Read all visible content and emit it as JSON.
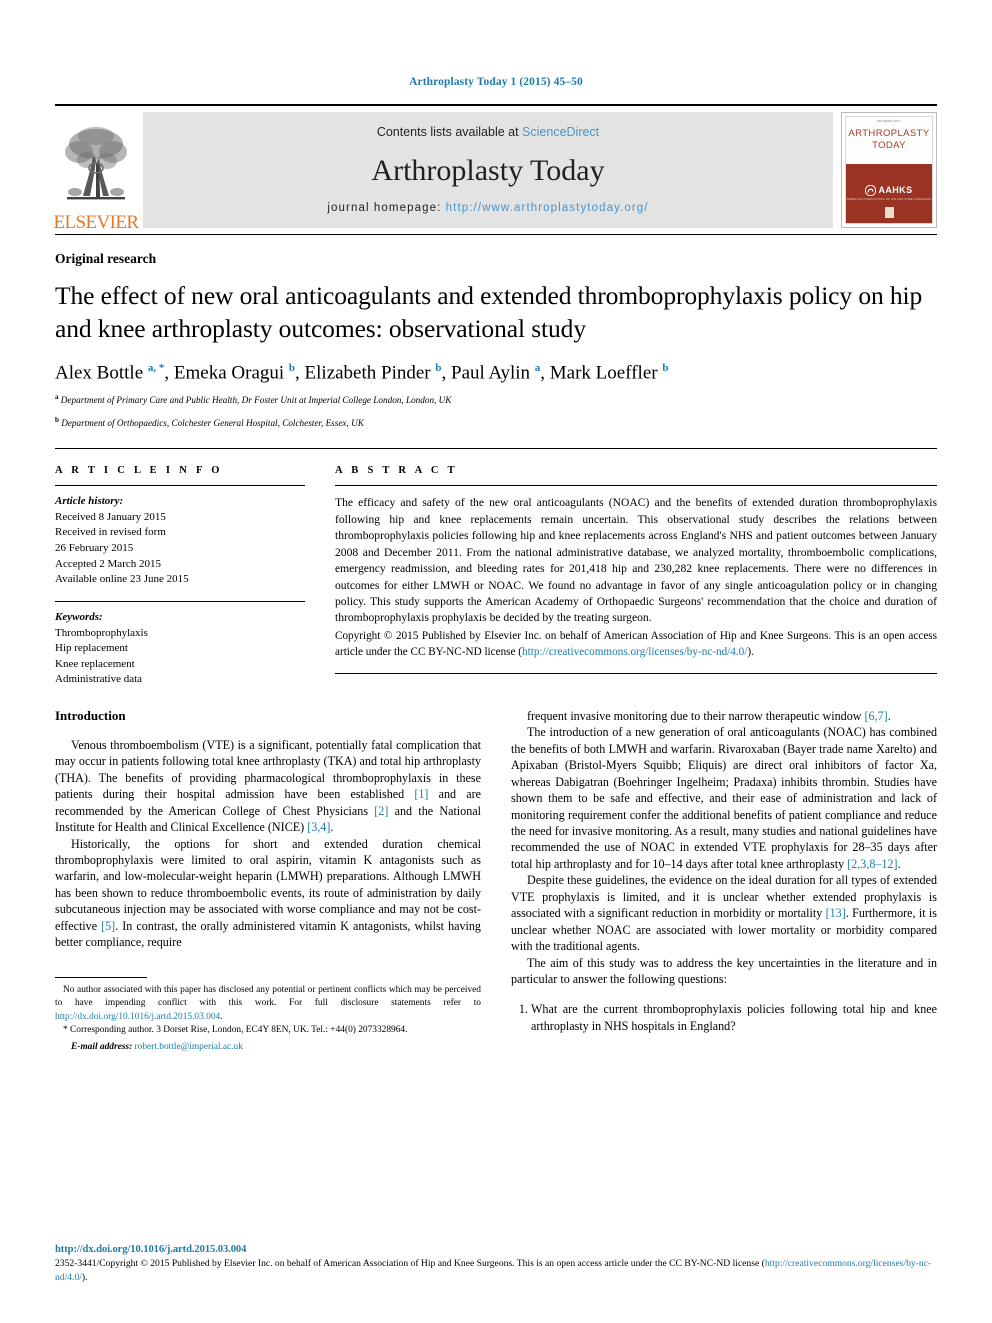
{
  "running_head": "Arthroplasty Today 1 (2015) 45–50",
  "masthead": {
    "contents_prefix": "Contents lists available at ",
    "sciencedirect": "ScienceDirect",
    "journal_name": "Arthroplasty Today",
    "homepage_prefix": "journal homepage: ",
    "homepage_url": "http://www.arthroplastytoday.org/",
    "publisher_word": "ELSEVIER",
    "publisher_color": "#e87722",
    "link_color": "#4a94c8"
  },
  "cover": {
    "micro_line": "ARTHROPLASTY",
    "title_line1": "ARTHROPLASTY",
    "title_line2": "TODAY",
    "society": "AAHKS",
    "society_sub": "AMERICAN ASSOCIATION OF HIP AND KNEE SURGEONS",
    "body_color": "#9b3324",
    "title_color": "#9e3a28"
  },
  "article": {
    "type": "Original research",
    "title": "The effect of new oral anticoagulants and extended thromboprophylaxis policy on hip and knee arthroplasty outcomes: observational study",
    "authors_html": "Alex Bottle <sup>a, *</sup>, Emeka Oragui <sup>b</sup>, Elizabeth Pinder <sup>b</sup>, Paul Aylin <sup>a</sup>, Mark Loeffler <sup>b</sup>",
    "affiliation_a": "Department of Primary Care and Public Health, Dr Foster Unit at Imperial College London, London, UK",
    "affiliation_b": "Department of Orthopaedics, Colchester General Hospital, Colchester, Essex, UK"
  },
  "info": {
    "heading": "A R T I C L E   I N F O",
    "history_label": "Article history:",
    "history": [
      "Received 8 January 2015",
      "Received in revised form",
      "26 February 2015",
      "Accepted 2 March 2015",
      "Available online 23 June 2015"
    ],
    "keywords_label": "Keywords:",
    "keywords": [
      "Thromboprophylaxis",
      "Hip replacement",
      "Knee replacement",
      "Administrative data"
    ]
  },
  "abstract": {
    "heading": "A B S T R A C T",
    "body": "The efficacy and safety of the new oral anticoagulants (NOAC) and the benefits of extended duration thromboprophylaxis following hip and knee replacements remain uncertain. This observational study describes the relations between thromboprophylaxis policies following hip and knee replacements across England's NHS and patient outcomes between January 2008 and December 2011. From the national administrative database, we analyzed mortality, thromboembolic complications, emergency readmission, and bleeding rates for 201,418 hip and 230,282 knee replacements. There were no differences in outcomes for either LMWH or NOAC. We found no advantage in favor of any single anticoagulation policy or in changing policy. This study supports the American Academy of Orthopaedic Surgeons' recommendation that the choice and duration of thromboprophylaxis prophylaxis be decided by the treating surgeon.",
    "copyright_text": "Copyright © 2015 Published by Elsevier Inc. on behalf of American Association of Hip and Knee Surgeons. This is an open access article under the CC BY-NC-ND license (",
    "license_url": "http://creativecommons.org/licenses/by-nc-nd/4.0/",
    "copyright_tail": ")."
  },
  "intro": {
    "heading": "Introduction",
    "p1_a": "Venous thromboembolism (VTE) is a significant, potentially fatal complication that may occur in patients following total knee arthroplasty (TKA) and total hip arthroplasty (THA). The benefits of providing pharmacological thromboprophylaxis in these patients during their hospital admission have been established ",
    "p1_c1": "[1]",
    "p1_b": " and are recommended by the American College of Chest Physicians ",
    "p1_c2": "[2]",
    "p1_c": " and the National Institute for Health and Clinical Excellence (NICE) ",
    "p1_c3": "[3,4]",
    "p1_d": ".",
    "p2_a": "Historically, the options for short and extended duration chemical thromboprophylaxis were limited to oral aspirin, vitamin K antagonists such as warfarin, and low-molecular-weight heparin (LMWH) preparations. Although LMWH has been shown to reduce thromboembolic events, its route of administration by daily subcutaneous injection may be associated with worse compliance and may not be cost-effective ",
    "p2_c1": "[5]",
    "p2_b": ". In contrast, the orally administered vitamin K antagonists, whilst having better compliance, require"
  },
  "right_col": {
    "p3_a": "frequent invasive monitoring due to their narrow therapeutic window ",
    "p3_c1": "[6,7]",
    "p3_b": ".",
    "p4_a": "The introduction of a new generation of oral anticoagulants (NOAC) has combined the benefits of both LMWH and warfarin. Rivaroxaban (Bayer trade name Xarelto) and Apixaban (Bristol-Myers Squibb; Eliquis) are direct oral inhibitors of factor Xa, whereas Dabigatran (Boehringer Ingelheim; Pradaxa) inhibits thrombin. Studies have shown them to be safe and effective, and their ease of administration and lack of monitoring requirement confer the additional benefits of patient compliance and reduce the need for invasive monitoring. As a result, many studies and national guidelines have recommended the use of NOAC in extended VTE prophylaxis for 28–35 days after total hip arthroplasty and for 10–14 days after total knee arthroplasty ",
    "p4_c1": "[2,3,8–12]",
    "p4_b": ".",
    "p5_a": "Despite these guidelines, the evidence on the ideal duration for all types of extended VTE prophylaxis is limited, and it is unclear whether extended prophylaxis is associated with a significant reduction in morbidity or mortality ",
    "p5_c1": "[13]",
    "p5_b": ". Furthermore, it is unclear whether NOAC are associated with lower mortality or morbidity compared with the traditional agents.",
    "p6": "The aim of this study was to address the key uncertainties in the literature and in particular to answer the following questions:",
    "question1": "What are the current thromboprophylaxis policies following total hip and knee arthroplasty in NHS hospitals in England?"
  },
  "footnotes": {
    "disclosure_a": "No author associated with this paper has disclosed any potential or pertinent conflicts which may be perceived to have impending conflict with this work. For full disclosure statements refer to ",
    "disclosure_link": "http://dx.doi.org/10.1016/j.artd.2015.03.004",
    "disclosure_b": ".",
    "corresponding": "* Corresponding author. 3 Dorset Rise, London, EC4Y 8EN, UK. Tel.: +44(0) 2073328964.",
    "email_label": "E-mail address:",
    "email": "robert.bottle@imperial.ac.uk"
  },
  "footer": {
    "doi": "http://dx.doi.org/10.1016/j.artd.2015.03.004",
    "issn_copy_a": "2352-3441/Copyright © 2015 Published by Elsevier Inc. on behalf of American Association of Hip and Knee Surgeons. This is an open access article under the CC BY-NC-ND license (",
    "license_url": "http://creativecommons.org/licenses/by-nc-nd/4.0/",
    "issn_copy_b": ")."
  }
}
